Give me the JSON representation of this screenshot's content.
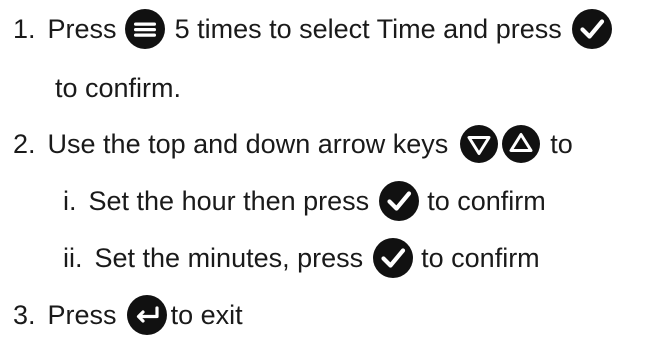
{
  "steps": [
    {
      "number": "1.",
      "press": "Press",
      "text_a": "5 times to select Time and press",
      "text_b": "to confirm."
    },
    {
      "number": "2.",
      "text_a": "Use the top and down arrow keys",
      "text_b": "to",
      "substeps": [
        {
          "number": "i.",
          "text_a": "Set the hour then press",
          "text_b": "to confirm"
        },
        {
          "number": "ii.",
          "text_a": "Set the minutes, press",
          "text_b": "to confirm"
        }
      ]
    },
    {
      "number": "3.",
      "press": "Press",
      "text_a": "to exit"
    }
  ],
  "icons": {
    "menu": "menu-icon",
    "confirm": "checkmark-icon",
    "down": "down-arrow-icon",
    "up": "up-arrow-icon",
    "back": "return-icon"
  },
  "colors": {
    "text": "#1a1a1a",
    "icon": "#111111"
  }
}
